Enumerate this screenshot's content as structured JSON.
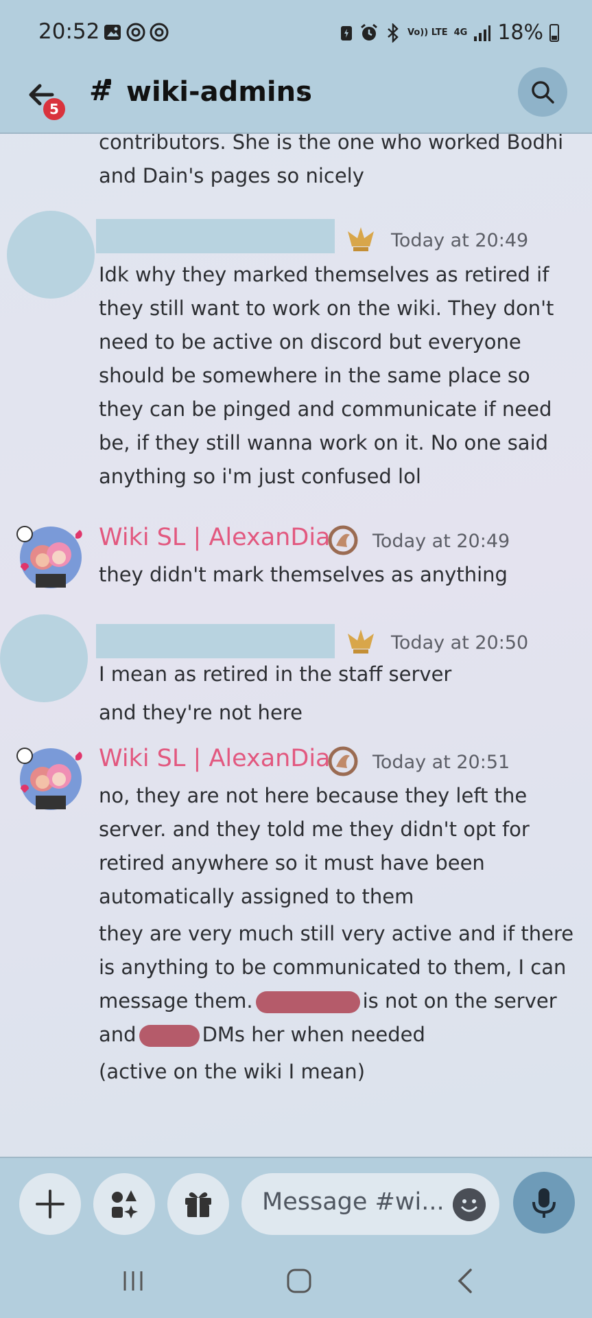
{
  "status_bar": {
    "time": "20:52",
    "left_icons": [
      "image-icon",
      "threads-icon",
      "threads-icon"
    ],
    "right_icons": [
      "battery-saver-icon",
      "alarm-icon",
      "bluetooth-icon",
      "volte-icon",
      "4g-icon",
      "signal-icon"
    ],
    "volte_label": "Vo)) LTE",
    "network_label": "4G",
    "battery_percent": "18%"
  },
  "header": {
    "back_icon": "arrow-left-icon",
    "unread_badge": "5",
    "channel_icon": "hash-lock-icon",
    "channel_name": "wiki-admins",
    "chevron": "›",
    "search_icon": "search-icon"
  },
  "messages": [
    {
      "id": "m0",
      "continuation": true,
      "lines": [
        "contributors. She is the one who worked Bodhi",
        "and Dain's pages so nicely"
      ]
    },
    {
      "id": "m1",
      "author": "[redacted]",
      "role_icon": "gold-crest-icon",
      "timestamp": "Today at 20:49",
      "lines": [
        "Idk why they marked themselves as retired if",
        "they still want to work on the wiki. They don't",
        "need to be active on discord but everyone",
        "should be somewhere in the same place so",
        "they can be pinged and communicate if need",
        "be, if they still wanna work on it. No one said",
        "anything so i'm just confused lol"
      ]
    },
    {
      "id": "m2",
      "author": "Wiki SL | AlexanDia",
      "author_color": "#e2587f",
      "role_icon": "dragon-icon",
      "timestamp": "Today at 20:49",
      "lines": [
        "they didn't mark themselves as anything"
      ]
    },
    {
      "id": "m3",
      "author": "[redacted]",
      "role_icon": "gold-crest-icon",
      "timestamp": "Today at 20:50",
      "lines": [
        "I mean as retired in the staff server"
      ],
      "followup": [
        "and they're not here"
      ]
    },
    {
      "id": "m4",
      "author": "Wiki SL | AlexanDia",
      "author_color": "#e2587f",
      "role_icon": "dragon-icon",
      "timestamp": "Today at 20:51",
      "lines": [
        "no, they are not here because they left the",
        "server. and they told me they didn't opt for",
        "retired anywhere so it must have been",
        "automatically assigned to them"
      ],
      "followup": [
        "they are very much still very active and if there",
        "is anything to be communicated to them, I can"
      ],
      "followup_line3_prefix": "message them.",
      "followup_line3_suffix": "is not on the server",
      "followup_line4_prefix": "and",
      "followup_line4_suffix": "DMs her when needed",
      "followup2": [
        "(active on the wiki I mean)"
      ]
    }
  ],
  "composer": {
    "add_icon": "plus-icon",
    "apps_icon": "apps-icon",
    "gift_icon": "gift-icon",
    "placeholder": "Message #wi...",
    "emoji_icon": "emoji-icon",
    "mic_icon": "microphone-icon"
  },
  "navbar": {
    "recents_icon": "recents-icon",
    "home_icon": "home-icon",
    "back_icon": "back-chevron-icon"
  }
}
